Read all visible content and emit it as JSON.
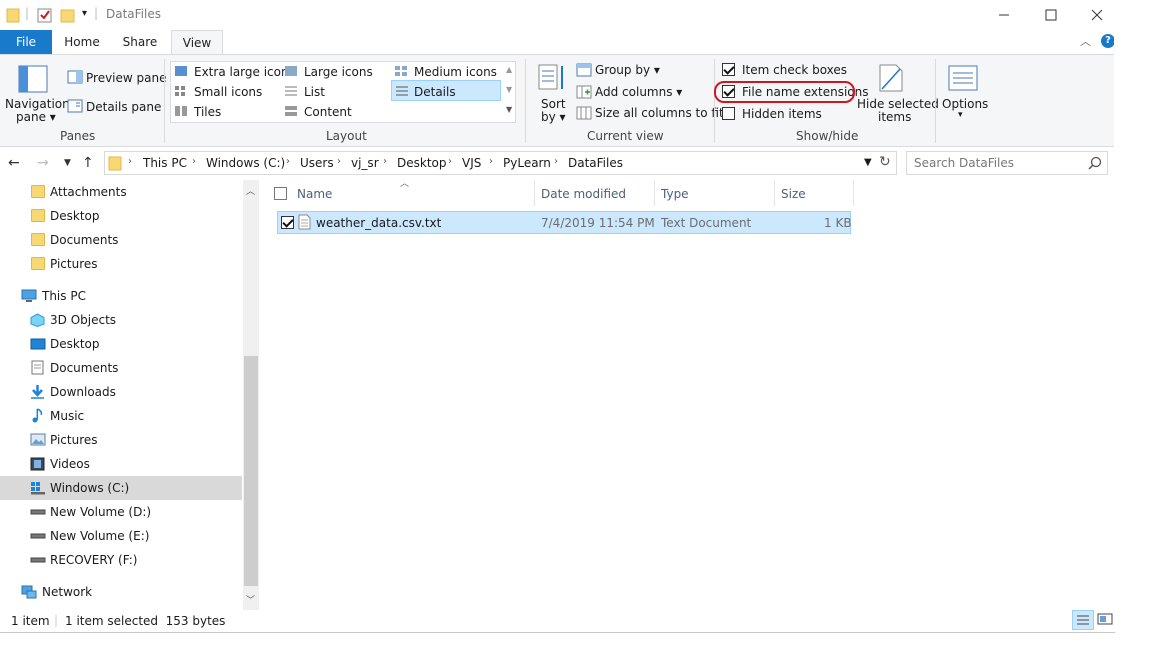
{
  "window": {
    "title": "DataFiles",
    "quick_access_arrow": "▾"
  },
  "ribbon_tabs": {
    "file": "File",
    "home": "Home",
    "share": "Share",
    "view": "View"
  },
  "ribbon": {
    "panes": {
      "navigation_pane": "Navigation",
      "navigation_pane_2": "pane ▾",
      "preview_pane": "Preview pane",
      "details_pane": "Details pane",
      "group_label": "Panes"
    },
    "layout": {
      "extra_large_icons": "Extra large icons",
      "large_icons": "Large icons",
      "medium_icons": "Medium icons",
      "small_icons": "Small icons",
      "list": "List",
      "details": "Details",
      "tiles": "Tiles",
      "content": "Content",
      "group_label": "Layout"
    },
    "current_view": {
      "sort_by": "Sort",
      "sort_by_2": "by ▾",
      "group_by": "Group by ▾",
      "add_columns": "Add columns ▾",
      "size_all_columns": "Size all columns to fit",
      "group_label": "Current view"
    },
    "show_hide": {
      "item_check_boxes": "Item check boxes",
      "item_check_boxes_checked": true,
      "file_name_extensions": "File name extensions",
      "file_name_extensions_checked": true,
      "hidden_items": "Hidden items",
      "hidden_items_checked": false,
      "hide_selected_items": "Hide selected",
      "hide_selected_items_2": "items",
      "group_label": "Show/hide"
    },
    "options": {
      "label": "Options",
      "arrow": "▾"
    }
  },
  "address_bar": {
    "breadcrumbs": [
      "This PC",
      "Windows (C:)",
      "Users",
      "vj_sr",
      "Desktop",
      "VJS",
      "PyLearn",
      "DataFiles"
    ],
    "search_placeholder": "Search DataFiles"
  },
  "sidebar": {
    "quick_access_items": [
      "Attachments",
      "Desktop",
      "Documents",
      "Pictures"
    ],
    "this_pc": "This PC",
    "this_pc_items": [
      "3D Objects",
      "Desktop",
      "Documents",
      "Downloads",
      "Music",
      "Pictures",
      "Videos",
      "Windows (C:)",
      "New Volume (D:)",
      "New Volume (E:)",
      "RECOVERY (F:)"
    ],
    "network": "Network",
    "selected": "Windows (C:)"
  },
  "file_list": {
    "columns": [
      "Name",
      "Date modified",
      "Type",
      "Size"
    ],
    "rows": [
      {
        "name": "weather_data.csv.txt",
        "date_modified": "7/4/2019 11:54 PM",
        "type": "Text Document",
        "size": "1 KB",
        "selected": true,
        "checked": true
      }
    ]
  },
  "status_bar": {
    "item_count": "1 item",
    "selection": "1 item selected  153 bytes"
  },
  "colors": {
    "accent": "#1979ca",
    "selection": "#cce8ff",
    "highlight_circle": "#d0161e"
  }
}
